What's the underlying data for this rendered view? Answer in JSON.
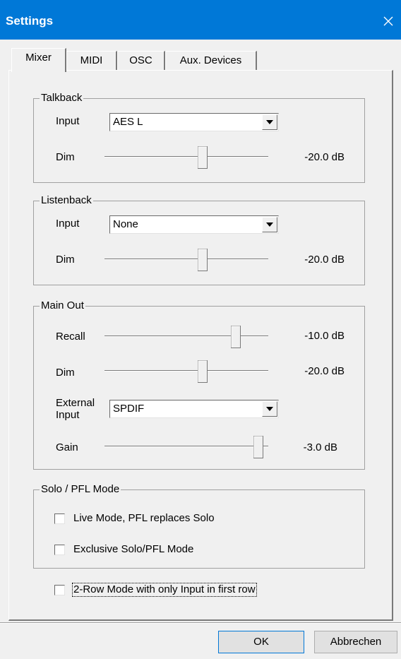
{
  "window": {
    "title": "Settings",
    "close_icon": "close-icon",
    "title_bar_color": "#0078d7"
  },
  "tabs": [
    {
      "label": "Mixer",
      "active": true
    },
    {
      "label": "MIDI",
      "active": false
    },
    {
      "label": "OSC",
      "active": false
    },
    {
      "label": "Aux. Devices",
      "active": false
    }
  ],
  "talkback": {
    "title": "Talkback",
    "input_label": "Input",
    "input_value": "AES L",
    "dim_label": "Dim",
    "dim_value": "-20.0 dB",
    "dim_level": 0.6
  },
  "listenback": {
    "title": "Listenback",
    "input_label": "Input",
    "input_value": "None",
    "dim_label": "Dim",
    "dim_value": "-20.0 dB",
    "dim_level": 0.6
  },
  "main_out": {
    "title": "Main Out",
    "recall_label": "Recall",
    "recall_value": "-10.0 dB",
    "recall_level": 0.8,
    "dim_label": "Dim",
    "dim_value": "-20.0 dB",
    "dim_level": 0.6,
    "external_input_label_line1": "External",
    "external_input_label_line2": "Input",
    "external_input_value": "SPDIF",
    "gain_label": "Gain",
    "gain_value": "-3.0 dB",
    "gain_level": 0.94
  },
  "solo": {
    "title": "Solo / PFL Mode",
    "live_mode_label": "Live Mode,  PFL replaces Solo",
    "live_mode_checked": false,
    "exclusive_label": "Exclusive Solo/PFL Mode",
    "exclusive_checked": false
  },
  "two_row": {
    "label": "2-Row Mode with only Input in first row",
    "checked": false
  },
  "buttons": {
    "ok": "OK",
    "cancel": "Abbrechen"
  }
}
